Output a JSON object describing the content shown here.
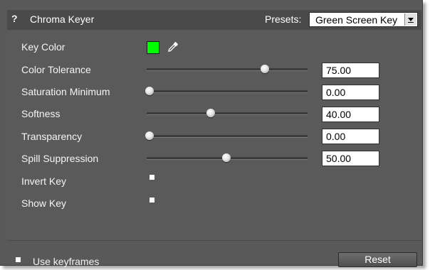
{
  "header": {
    "help_glyph": "?",
    "title": "Chroma Keyer",
    "presets_label": "Presets:",
    "presets_value": "Green Screen Key"
  },
  "key_color": {
    "label": "Key Color",
    "swatch_color": "#00ff00",
    "picker_icon": "eyedropper-icon"
  },
  "sliders": [
    {
      "label": "Color Tolerance",
      "value": "75.00",
      "level": 0.75
    },
    {
      "label": "Saturation Minimum",
      "value": "0.00",
      "level": 0.0
    },
    {
      "label": "Softness",
      "value": "40.00",
      "level": 0.4
    },
    {
      "label": "Transparency",
      "value": "0.00",
      "level": 0.0
    },
    {
      "label": "Spill Suppression",
      "value": "50.00",
      "level": 0.5
    }
  ],
  "toggles": [
    {
      "label": "Invert Key",
      "checked": false
    },
    {
      "label": "Show Key",
      "checked": false
    }
  ],
  "footer": {
    "use_keyframes_label": "Use keyframes",
    "reset_label": "Reset"
  },
  "colors": {
    "panel_bg": "#595959",
    "header_bg": "#4a4a4a",
    "key_color": "#00ff00"
  }
}
